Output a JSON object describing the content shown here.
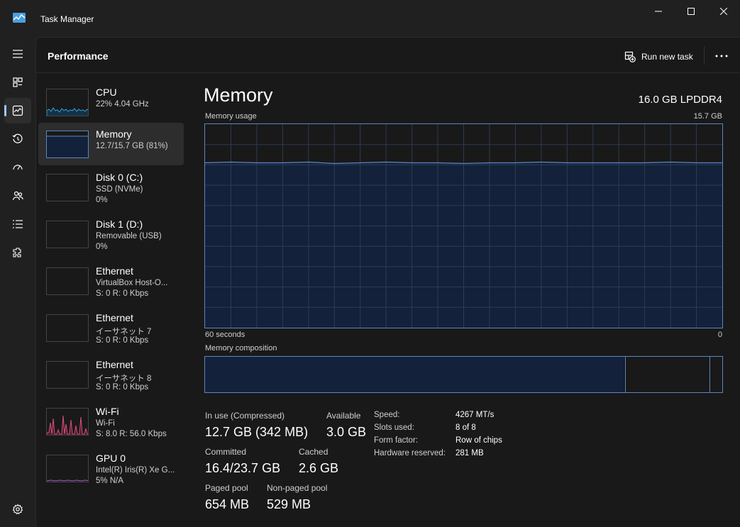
{
  "window": {
    "title": "Task Manager",
    "icon": "task-manager-icon"
  },
  "nav": {
    "items": [
      {
        "name": "hamburger-menu-icon"
      },
      {
        "name": "processes-icon"
      },
      {
        "name": "performance-icon",
        "active": true
      },
      {
        "name": "app-history-icon"
      },
      {
        "name": "startup-apps-icon"
      },
      {
        "name": "users-icon"
      },
      {
        "name": "details-icon"
      },
      {
        "name": "services-icon"
      },
      {
        "name": "settings-icon"
      }
    ]
  },
  "header": {
    "title": "Performance",
    "run_new_task": "Run new task"
  },
  "devices": [
    {
      "name": "CPU",
      "sub1": "22%  4.04 GHz",
      "sub2": ""
    },
    {
      "name": "Memory",
      "sub1": "12.7/15.7 GB (81%)",
      "sub2": ""
    },
    {
      "name": "Disk 0 (C:)",
      "sub1": "SSD (NVMe)",
      "sub2": "0%"
    },
    {
      "name": "Disk 1 (D:)",
      "sub1": "Removable (USB)",
      "sub2": "0%"
    },
    {
      "name": "Ethernet",
      "sub1": "VirtualBox Host-O...",
      "sub2": "S: 0  R: 0 Kbps"
    },
    {
      "name": "Ethernet",
      "sub1": "イーサネット 7",
      "sub2": "S: 0  R: 0 Kbps"
    },
    {
      "name": "Ethernet",
      "sub1": "イーサネット 8",
      "sub2": "S: 0  R: 0 Kbps"
    },
    {
      "name": "Wi-Fi",
      "sub1": "Wi-Fi",
      "sub2": "S: 8.0  R: 56.0 Kbps"
    },
    {
      "name": "GPU 0",
      "sub1": "Intel(R) Iris(R) Xe G...",
      "sub2": "5%  N/A"
    }
  ],
  "memory": {
    "title": "Memory",
    "spec": "16.0 GB LPDDR4",
    "usage_label": "Memory usage",
    "usage_max": "15.7 GB",
    "x_left": "60 seconds",
    "x_right": "0",
    "composition_label": "Memory composition",
    "composition": {
      "in_use_fraction": 0.81,
      "modified_fraction": 0.0,
      "standby_fraction": 0.165,
      "free_fraction": 0.025
    },
    "usage_fraction": 0.81,
    "stats": {
      "in_use_label": "In use (Compressed)",
      "in_use_value": "12.7 GB (342 MB)",
      "available_label": "Available",
      "available_value": "3.0 GB",
      "committed_label": "Committed",
      "committed_value": "16.4/23.7 GB",
      "cached_label": "Cached",
      "cached_value": "2.6 GB",
      "paged_label": "Paged pool",
      "paged_value": "654 MB",
      "nonpaged_label": "Non-paged pool",
      "nonpaged_value": "529 MB"
    },
    "details": [
      {
        "key": "Speed:",
        "value": "4267 MT/s"
      },
      {
        "key": "Slots used:",
        "value": "8 of 8"
      },
      {
        "key": "Form factor:",
        "value": "Row of chips"
      },
      {
        "key": "Hardware reserved:",
        "value": "281 MB"
      }
    ]
  },
  "colors": {
    "accent": "#5c86c0",
    "fill": "#14213b",
    "cpu": "#3aa0d6",
    "wifi": "#d84f7a",
    "gpu": "#a35bd6"
  }
}
